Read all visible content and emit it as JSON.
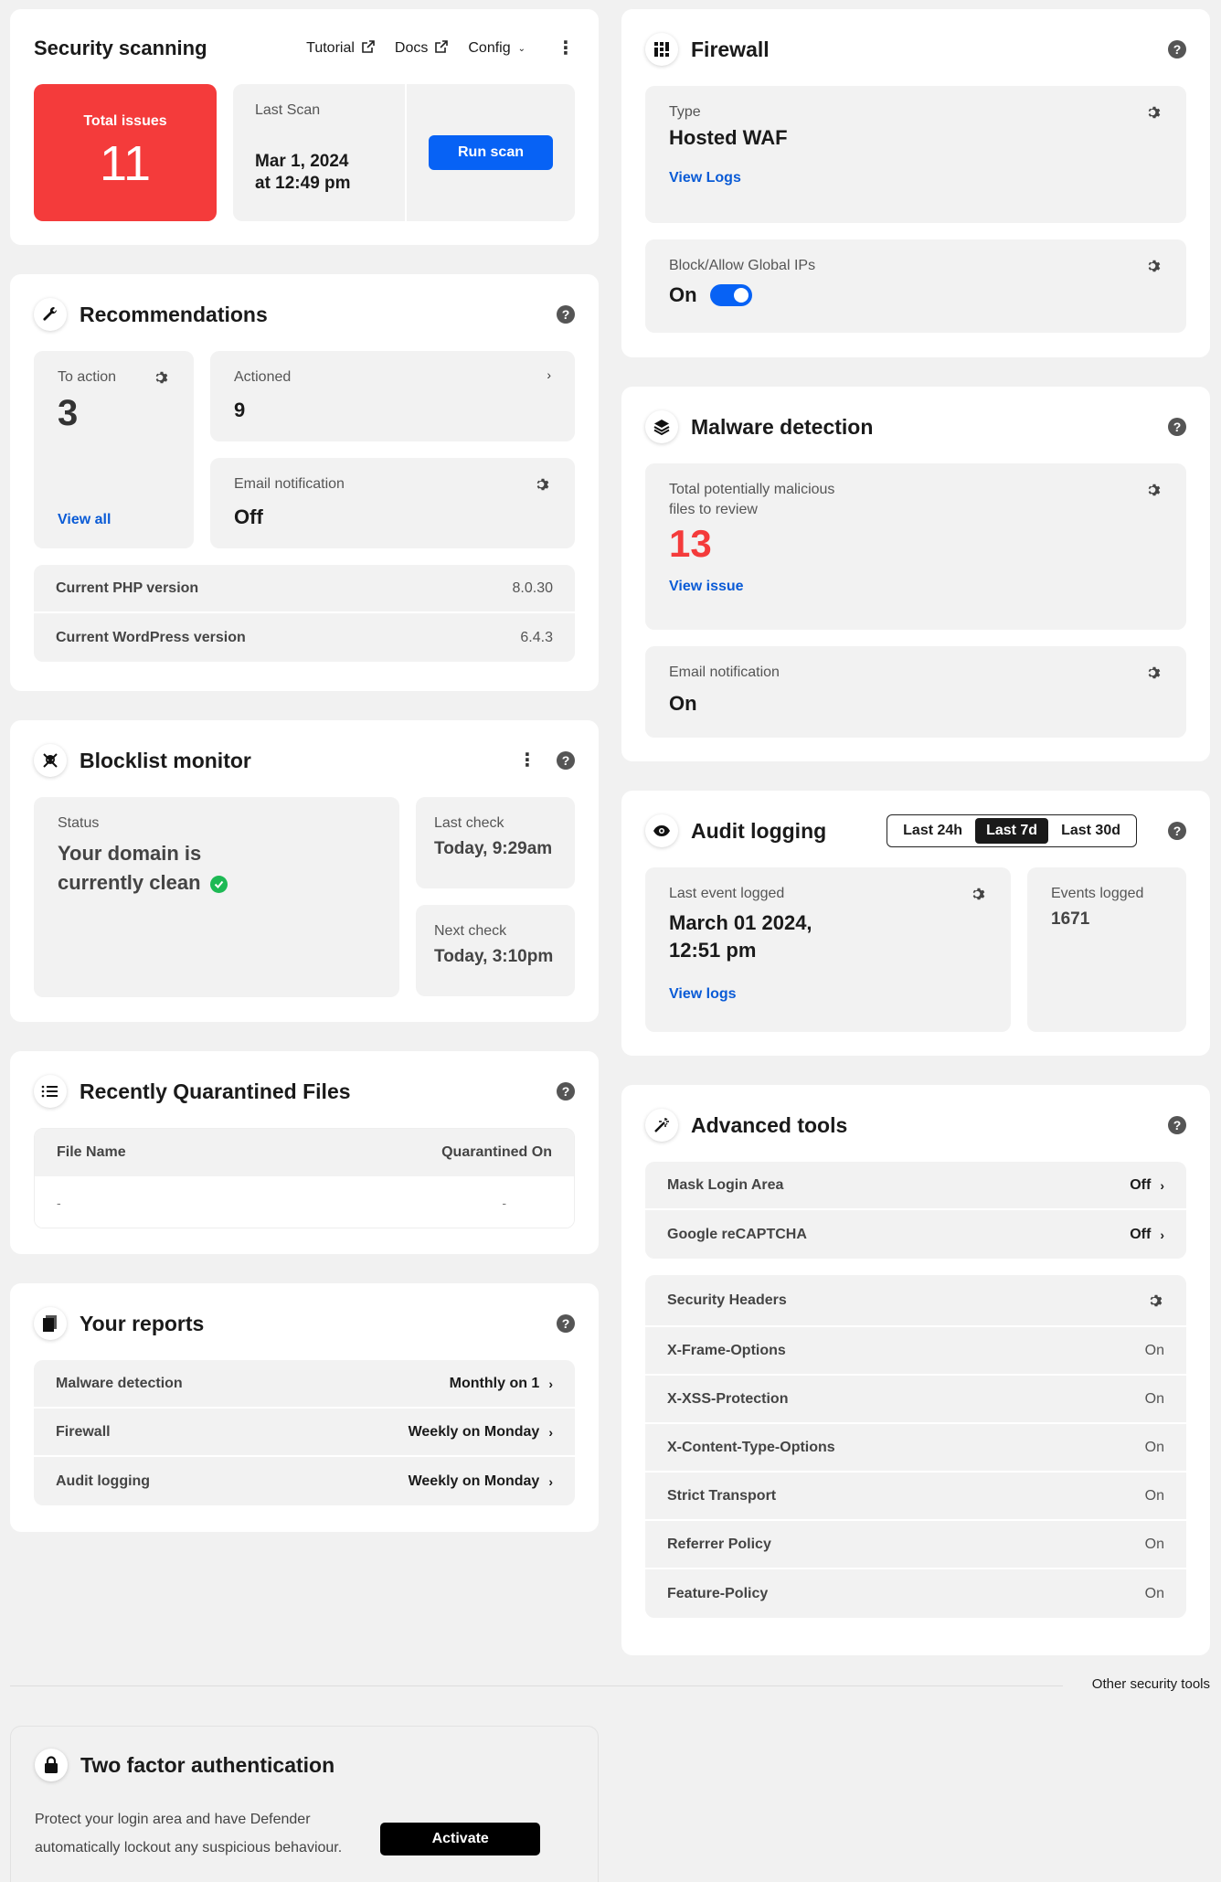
{
  "security": {
    "title": "Security scanning",
    "tutorial": "Tutorial",
    "docs": "Docs",
    "config": "Config",
    "total_issues_label": "Total issues",
    "total_issues": "11",
    "last_scan_label": "Last Scan",
    "last_scan_date": "Mar 1, 2024",
    "last_scan_time": "at 12:49 pm",
    "run_scan": "Run scan"
  },
  "recommendations": {
    "title": "Recommendations",
    "to_action_label": "To action",
    "to_action": "3",
    "view_all": "View all",
    "actioned_label": "Actioned",
    "actioned": "9",
    "email_label": "Email notification",
    "email_value": "Off",
    "rows": [
      {
        "label": "Current PHP version",
        "value": "8.0.30"
      },
      {
        "label": "Current WordPress version",
        "value": "6.4.3"
      }
    ]
  },
  "blocklist": {
    "title": "Blocklist monitor",
    "status_label": "Status",
    "status_value": "Your domain is currently clean",
    "last_check_label": "Last check",
    "last_check": "Today, 9:29am",
    "next_check_label": "Next check",
    "next_check": "Today, 3:10pm"
  },
  "quarantine": {
    "title": "Recently Quarantined Files",
    "col_name": "File Name",
    "col_date": "Quarantined On",
    "empty_name": "-",
    "empty_date": "-"
  },
  "reports": {
    "title": "Your reports",
    "rows": [
      {
        "label": "Malware detection",
        "value": "Monthly on 1"
      },
      {
        "label": "Firewall",
        "value": "Weekly on Monday"
      },
      {
        "label": "Audit logging",
        "value": "Weekly on Monday"
      }
    ]
  },
  "firewall": {
    "title": "Firewall",
    "type_label": "Type",
    "type_value": "Hosted WAF",
    "view_logs": "View Logs",
    "global_label": "Block/Allow Global IPs",
    "global_value": "On",
    "global_enabled": true
  },
  "malware": {
    "title": "Malware detection",
    "total_label_1": "Total potentially malicious",
    "total_label_2": "files to review",
    "total_value": "13",
    "view_issue": "View issue",
    "email_label": "Email notification",
    "email_value": "On"
  },
  "audit": {
    "title": "Audit logging",
    "range_24h": "Last 24h",
    "range_7d": "Last 7d",
    "range_30d": "Last 30d",
    "selected_range": "Last 7d",
    "last_event_label": "Last event logged",
    "last_event_date": "March 01 2024,",
    "last_event_time": "12:51 pm",
    "view_logs": "View logs",
    "events_label": "Events logged",
    "events_value": "1671"
  },
  "advanced": {
    "title": "Advanced tools",
    "tools": [
      {
        "label": "Mask Login Area",
        "value": "Off"
      },
      {
        "label": "Google reCAPTCHA",
        "value": "Off"
      }
    ],
    "headers_title": "Security Headers",
    "headers": [
      {
        "label": "X-Frame-Options",
        "value": "On"
      },
      {
        "label": "X-XSS-Protection",
        "value": "On"
      },
      {
        "label": "X-Content-Type-Options",
        "value": "On"
      },
      {
        "label": "Strict Transport",
        "value": "On"
      },
      {
        "label": "Referrer Policy",
        "value": "On"
      },
      {
        "label": "Feature-Policy",
        "value": "On"
      }
    ]
  },
  "other_tools": "Other security tools",
  "twofa": {
    "title": "Two factor authentication",
    "desc_1": "Protect your login area and have Defender",
    "desc_2": "automatically lockout any suspicious behaviour.",
    "activate": "Activate"
  },
  "colors": {
    "danger": "#f43b3b",
    "link": "#0a5bd6",
    "primary": "#0762f5",
    "success": "#1db954"
  }
}
